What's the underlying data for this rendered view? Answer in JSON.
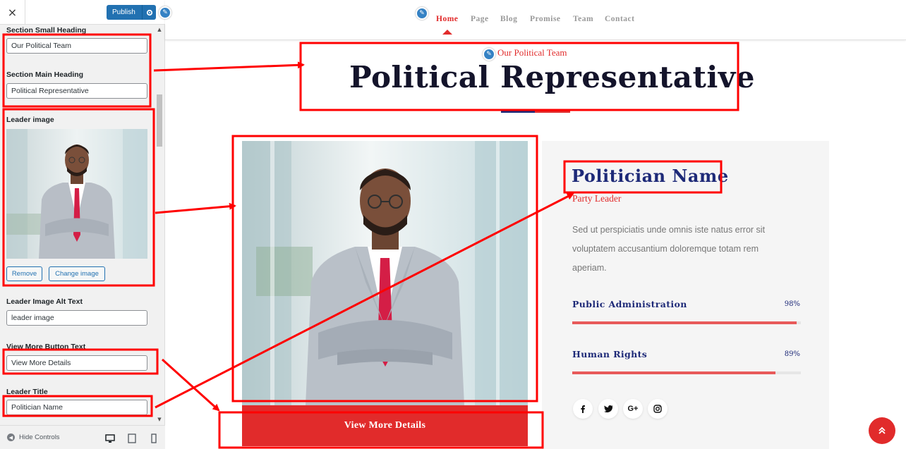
{
  "customizer": {
    "close_label": "×",
    "publish_label": "Publish",
    "fields": {
      "small_heading_label": "Section Small Heading",
      "small_heading_value": "Our Political Team",
      "main_heading_label": "Section Main Heading",
      "main_heading_value": "Political Representative",
      "leader_image_label": "Leader image",
      "remove_label": "Remove",
      "change_image_label": "Change image",
      "alt_text_label": "Leader Image Alt Text",
      "alt_text_value": "leader image",
      "view_more_label": "View More Button Text",
      "view_more_value": "View More Details",
      "leader_title_label": "Leader Title",
      "leader_title_value": "Politician Name"
    },
    "footer": {
      "hide_controls_label": "Hide Controls"
    }
  },
  "nav": {
    "items": [
      "Home",
      "Page",
      "Blog",
      "Promise",
      "Team",
      "Contact"
    ],
    "active": "Home"
  },
  "section": {
    "small_heading": "Our Political Team",
    "main_heading": "Political Representative"
  },
  "leader": {
    "button_text": "View More Details",
    "name": "Politician Name",
    "title": "Party Leader",
    "description": "Sed ut perspiciatis unde omnis iste natus error sit voluptatem accusantium doloremque totam rem aperiam.",
    "skills": [
      {
        "label": "Public Administration",
        "percent_text": "98%",
        "value": 0.98
      },
      {
        "label": "Human Rights",
        "percent_text": "89%",
        "value": 0.89
      }
    ],
    "social_icons": [
      "facebook-icon",
      "twitter-icon",
      "google-plus-icon",
      "instagram-icon"
    ]
  },
  "colors": {
    "accent_red": "#e12b2b",
    "navy": "#1e2a78",
    "wp_blue": "#2271b1",
    "annotation_red": "#ff0000"
  }
}
